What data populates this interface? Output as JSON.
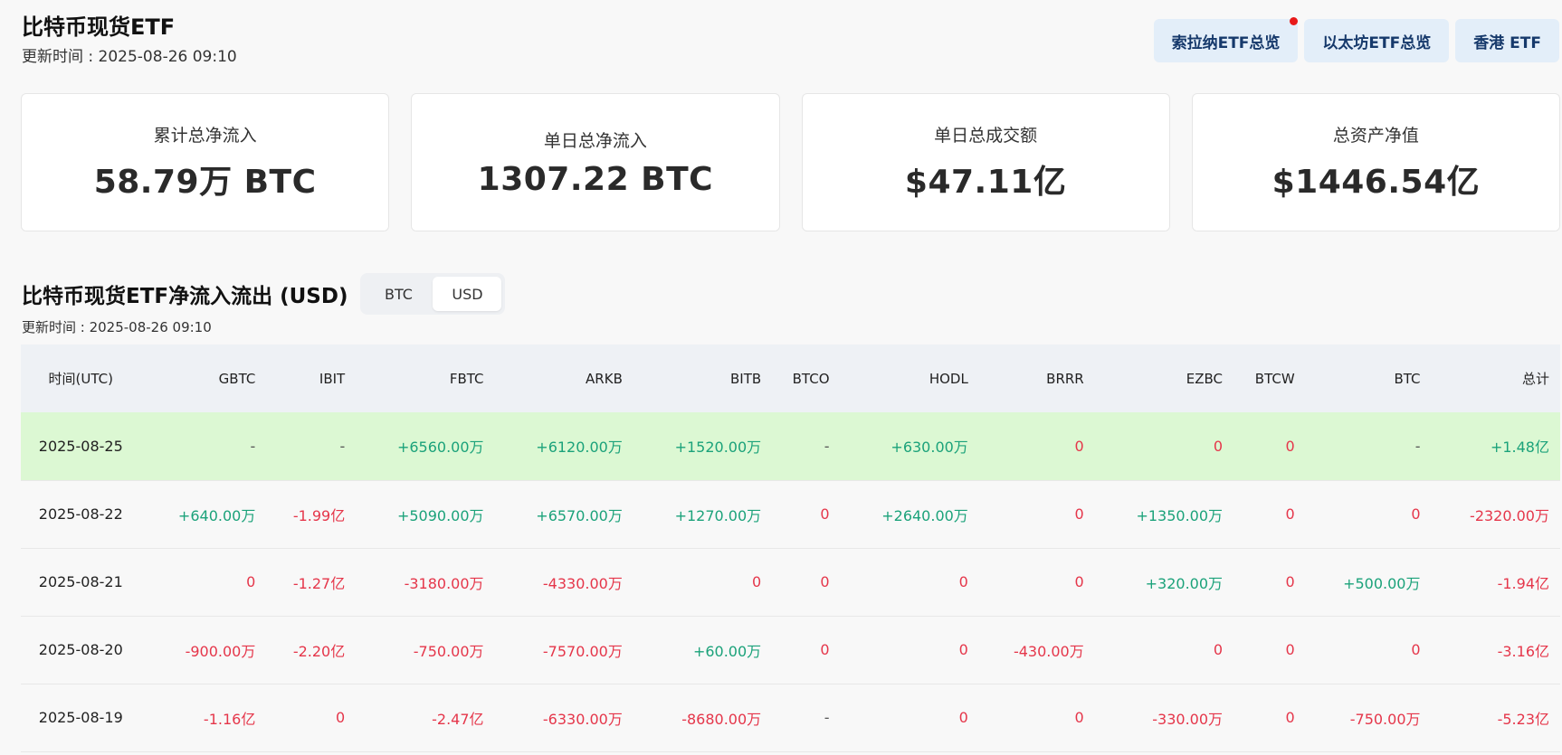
{
  "header": {
    "title": "比特币现货ETF",
    "update_time": "更新时间 : 2025-08-26 09:10"
  },
  "nav_buttons": [
    {
      "label": "索拉纳ETF总览",
      "has_dot": true
    },
    {
      "label": "以太坊ETF总览",
      "has_dot": false
    },
    {
      "label": "香港 ETF",
      "has_dot": false
    }
  ],
  "cards": [
    {
      "label": "累计总净流入",
      "value": "58.79万 BTC"
    },
    {
      "label": "单日总净流入",
      "value": "1307.22 BTC"
    },
    {
      "label": "单日总成交额",
      "value": "$47.11亿"
    },
    {
      "label": "总资产净值",
      "value": "$1446.54亿"
    }
  ],
  "section": {
    "title": "比特币现货ETF净流入流出 (USD)",
    "update_time": "更新时间 : 2025-08-26 09:10",
    "toggle": [
      {
        "label": "BTC",
        "active": false
      },
      {
        "label": "USD",
        "active": true
      }
    ]
  },
  "table": {
    "columns": [
      "时间(UTC)",
      "GBTC",
      "IBIT",
      "FBTC",
      "ARKB",
      "BITB",
      "BTCO",
      "HODL",
      "BRRR",
      "EZBC",
      "BTCW",
      "BTC",
      "总计"
    ],
    "rows": [
      {
        "highlight": true,
        "cells": [
          "2025-08-25",
          "-",
          "-",
          "+6560.00万",
          "+6120.00万",
          "+1520.00万",
          "-",
          "+630.00万",
          "0",
          "0",
          "0",
          "-",
          "+1.48亿"
        ]
      },
      {
        "highlight": false,
        "cells": [
          "2025-08-22",
          "+640.00万",
          "-1.99亿",
          "+5090.00万",
          "+6570.00万",
          "+1270.00万",
          "0",
          "+2640.00万",
          "0",
          "+1350.00万",
          "0",
          "0",
          "-2320.00万"
        ]
      },
      {
        "highlight": false,
        "cells": [
          "2025-08-21",
          "0",
          "-1.27亿",
          "-3180.00万",
          "-4330.00万",
          "0",
          "0",
          "0",
          "0",
          "+320.00万",
          "0",
          "+500.00万",
          "-1.94亿"
        ]
      },
      {
        "highlight": false,
        "cells": [
          "2025-08-20",
          "-900.00万",
          "-2.20亿",
          "-750.00万",
          "-7570.00万",
          "+60.00万",
          "0",
          "0",
          "-430.00万",
          "0",
          "0",
          "0",
          "-3.16亿"
        ]
      },
      {
        "highlight": false,
        "cells": [
          "2025-08-19",
          "-1.16亿",
          "0",
          "-2.47亿",
          "-6330.00万",
          "-8680.00万",
          "-",
          "0",
          "0",
          "-330.00万",
          "0",
          "-750.00万",
          "-5.23亿"
        ]
      }
    ]
  },
  "colors": {
    "positive": "#1ba27a",
    "negative": "#e5364a",
    "highlight_row": "#dcf8d3",
    "nav_button_bg": "#e3eef9",
    "nav_button_text": "#16396b",
    "notification_dot": "#e81919"
  }
}
